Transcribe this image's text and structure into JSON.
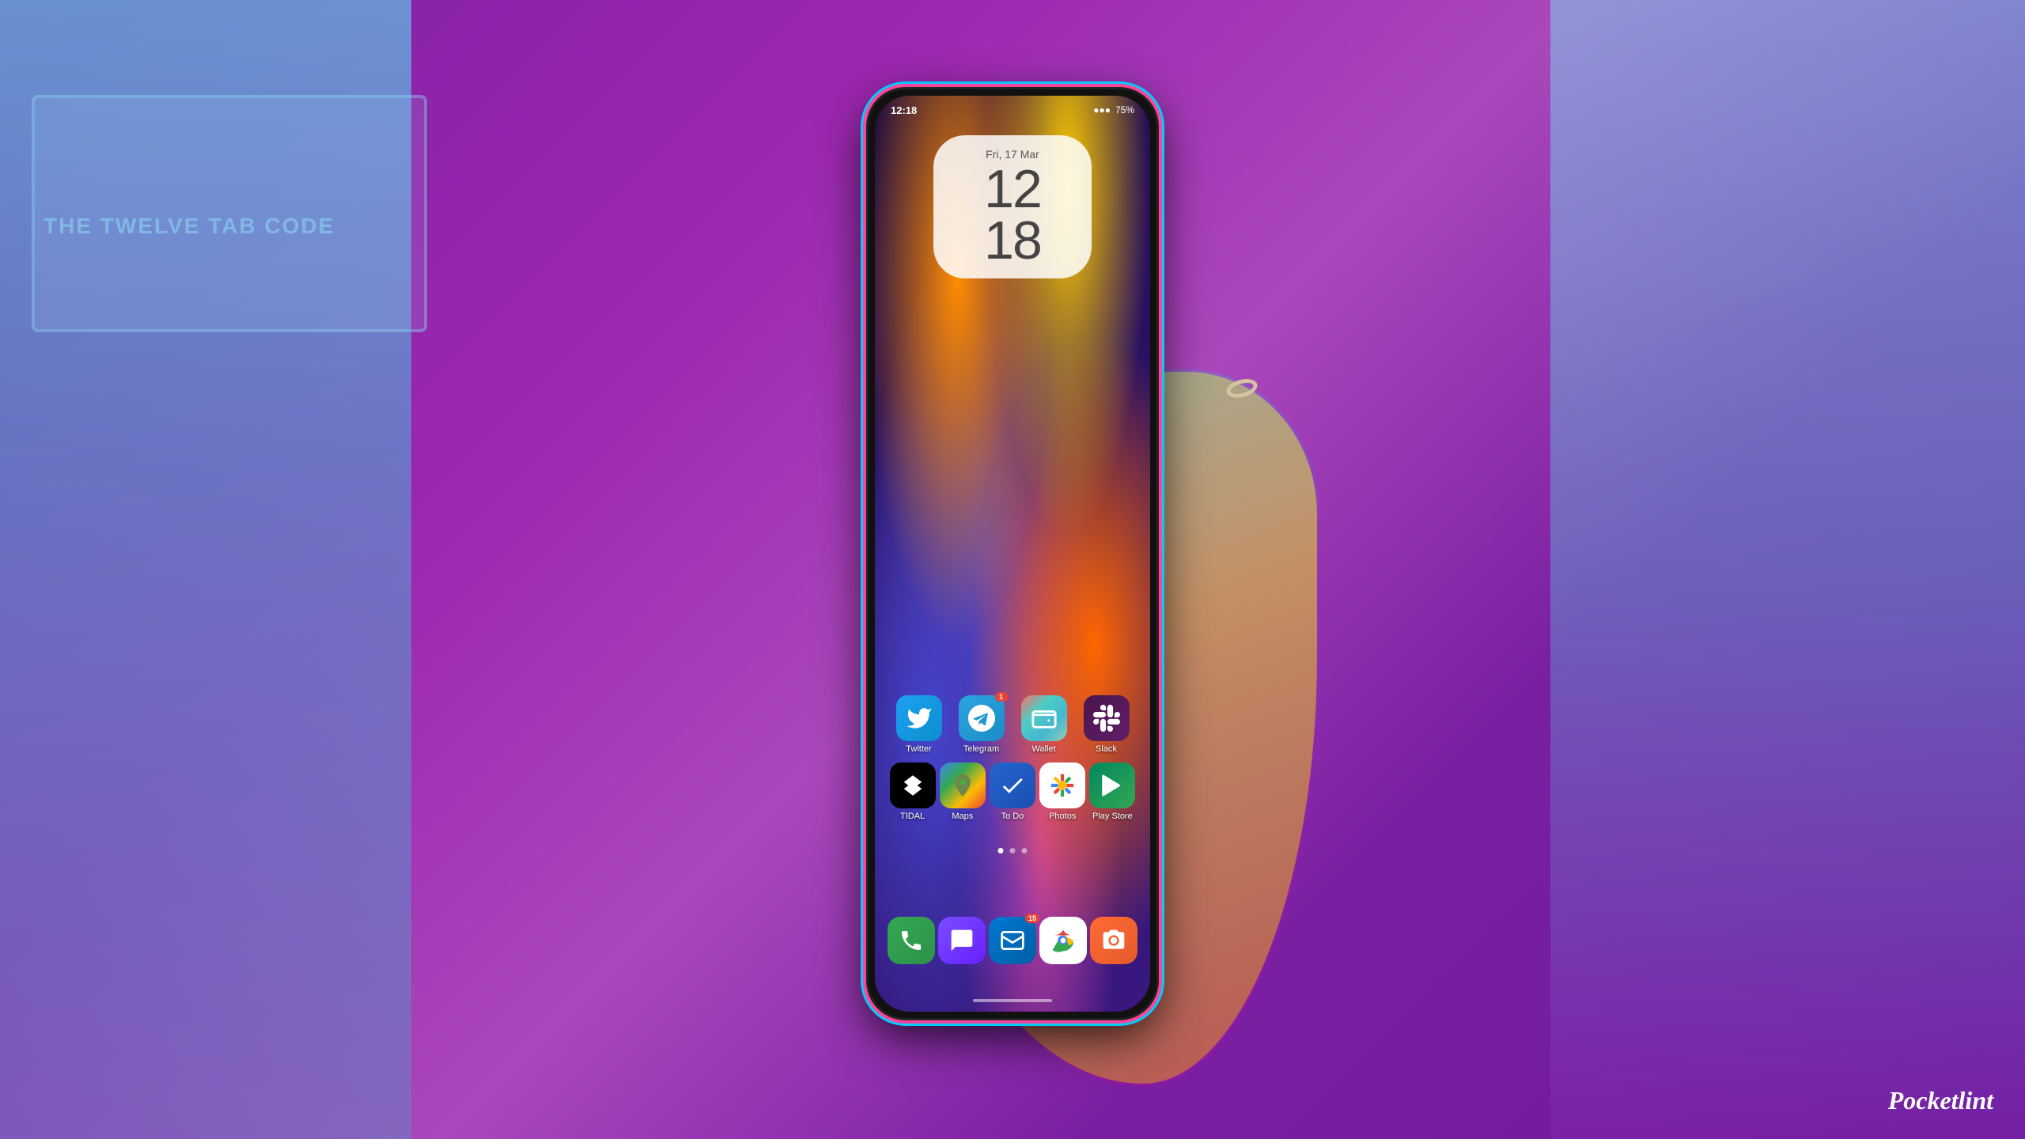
{
  "background": {
    "color": "#9b2fc9"
  },
  "watermark": {
    "text": "Pocketlint"
  },
  "phone": {
    "status_bar": {
      "time": "12:18",
      "battery": "75%",
      "signal_icons": "●●●"
    },
    "clock_widget": {
      "date": "Fri, 17 Mar",
      "hour": "12",
      "minute": "18"
    },
    "app_rows": [
      {
        "row": 1,
        "apps": [
          {
            "id": "twitter",
            "label": "Twitter",
            "icon_type": "twitter",
            "badge": null
          },
          {
            "id": "telegram",
            "label": "Telegram",
            "icon_type": "telegram",
            "badge": "1"
          },
          {
            "id": "wallet",
            "label": "Wallet",
            "icon_type": "wallet",
            "badge": null
          },
          {
            "id": "slack",
            "label": "Slack",
            "icon_type": "slack",
            "badge": null
          }
        ]
      },
      {
        "row": 2,
        "apps": [
          {
            "id": "tidal",
            "label": "TIDAL",
            "icon_type": "tidal",
            "badge": null
          },
          {
            "id": "maps",
            "label": "Maps",
            "icon_type": "maps",
            "badge": null
          },
          {
            "id": "todo",
            "label": "To Do",
            "icon_type": "todo",
            "badge": null
          },
          {
            "id": "photos",
            "label": "Photos",
            "icon_type": "photos",
            "badge": null
          },
          {
            "id": "playstore",
            "label": "Play Store",
            "icon_type": "playstore",
            "badge": null
          }
        ]
      }
    ],
    "dock_apps": [
      {
        "id": "phone",
        "label": "",
        "icon_type": "phone"
      },
      {
        "id": "chat",
        "label": "",
        "icon_type": "chat"
      },
      {
        "id": "outlook",
        "label": "",
        "icon_type": "outlook",
        "badge": "15"
      },
      {
        "id": "chrome",
        "label": "",
        "icon_type": "chrome"
      },
      {
        "id": "camera",
        "label": "",
        "icon_type": "camera"
      }
    ],
    "page_dots": {
      "total": 3,
      "active": 0
    }
  }
}
